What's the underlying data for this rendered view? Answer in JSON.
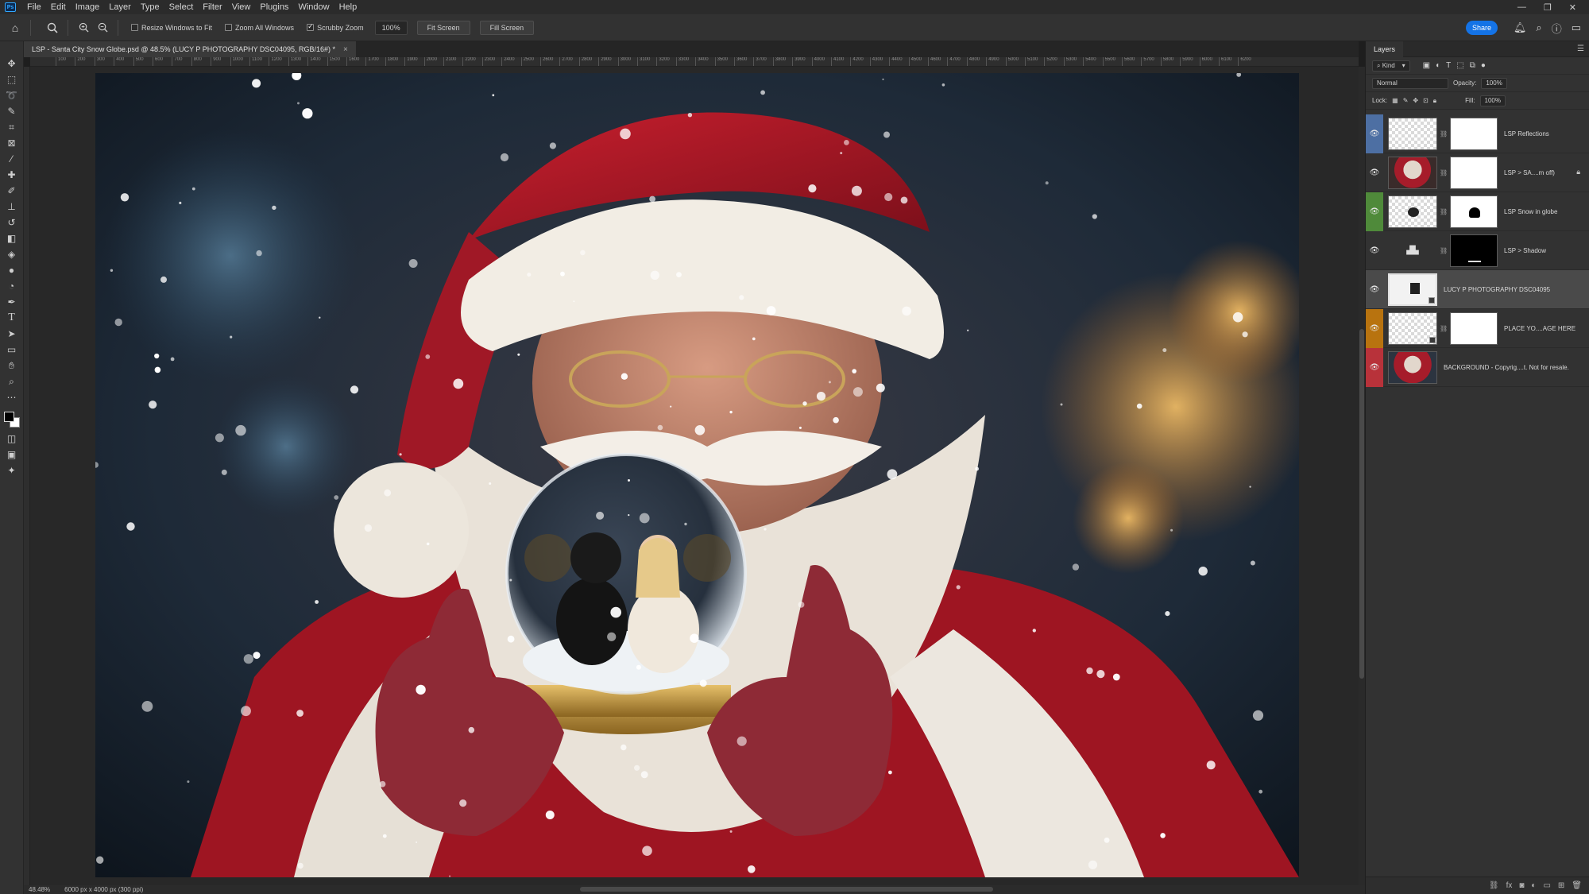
{
  "menubar": {
    "logo": "Ps",
    "items": [
      "File",
      "Edit",
      "Image",
      "Layer",
      "Type",
      "Select",
      "Filter",
      "View",
      "Plugins",
      "Window",
      "Help"
    ],
    "window_controls": [
      "—",
      "❐",
      "✕"
    ]
  },
  "options": {
    "resize_windows": "Resize Windows to Fit",
    "zoom_all": "Zoom All Windows",
    "scrubby_zoom": "Scrubby Zoom",
    "zoom_value": "100%",
    "fit_screen": "Fit Screen",
    "fill_screen": "Fill Screen",
    "share": "Share"
  },
  "document": {
    "tab_title": "LSP - Santa City Snow Globe.psd @ 48.5% (LUCY P PHOTOGRAPHY DSC04095, RGB/16#) *",
    "ruler_ticks": [
      "100",
      "200",
      "300",
      "400",
      "500",
      "600",
      "700",
      "800",
      "900",
      "1000",
      "1100",
      "1200",
      "1300",
      "1400",
      "1500",
      "1600",
      "1700",
      "1800",
      "1900",
      "2000",
      "2100",
      "2200",
      "2300",
      "2400",
      "2500",
      "2600",
      "2700",
      "2800",
      "2900",
      "3000",
      "3100",
      "3200",
      "3300",
      "3400",
      "3500",
      "3600",
      "3700",
      "3800",
      "3900",
      "4000",
      "4100",
      "4200",
      "4300",
      "4400",
      "4500",
      "4600",
      "4700",
      "4800",
      "4900",
      "5000",
      "5100",
      "5200",
      "5300",
      "5400",
      "5500",
      "5600",
      "5700",
      "5800",
      "5900",
      "6000",
      "6100",
      "6200"
    ]
  },
  "status": {
    "zoom": "48.48%",
    "dims": "6000 px x 4000 px (300 ppi)"
  },
  "panel": {
    "tab": "Layers",
    "kind": "Kind",
    "blend": "Normal",
    "opacity_label": "Opacity:",
    "opacity_value": "100%",
    "lock_label": "Lock:",
    "fill_label": "Fill:",
    "fill_value": "100%"
  },
  "layers": [
    {
      "name": "LSP Reflections",
      "color": "#4d6fa3"
    },
    {
      "name": "LSP > SA....m off)",
      "color": "#323232"
    },
    {
      "name": "LSP Snow in globe",
      "color": "#4f8a3a"
    },
    {
      "name": "LSP > Shadow",
      "color": "#323232"
    },
    {
      "name": "LUCY P PHOTOGRAPHY DSC04095",
      "color": "#323232"
    },
    {
      "name": "PLACE YO....AGE HERE",
      "color": "#b8730f"
    },
    {
      "name": "BACKGROUND - Copyrig....t. Not for resale.",
      "color": "#b8323a"
    }
  ],
  "colors": {
    "accent": "#1473e6",
    "santa_red": "#a8182a"
  }
}
